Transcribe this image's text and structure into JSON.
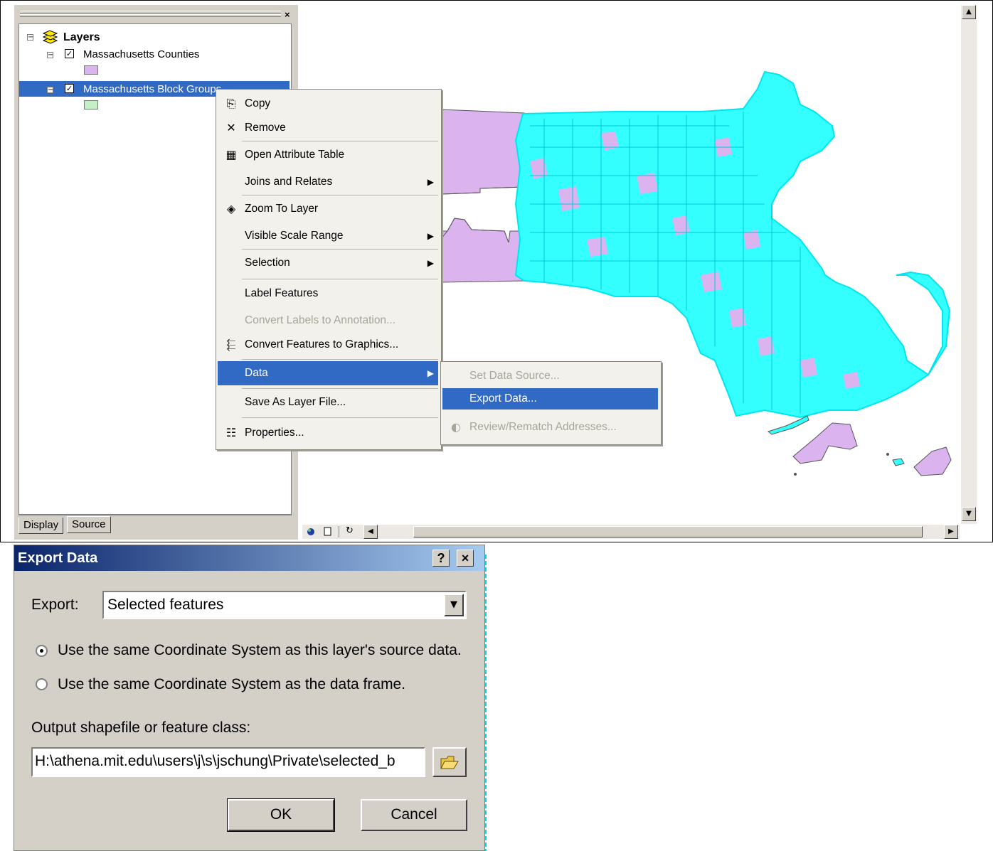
{
  "toc": {
    "close_glyph": "×",
    "root_label": "Layers",
    "layers": [
      {
        "name": "Massachusetts Counties",
        "checked": true,
        "swatch_color": "#dbb4ef"
      },
      {
        "name": "Massachusetts Block Groups",
        "checked": true,
        "swatch_color": "#c5f0c6",
        "selected": true
      }
    ],
    "tabs": {
      "display": "Display",
      "source": "Source"
    }
  },
  "map": {
    "county_fill": "#dbb4ef",
    "block_fill": "#33ffff",
    "toolbar_icons": [
      "globe-icon",
      "page-icon",
      "refresh-icon"
    ]
  },
  "context_menu": {
    "items": [
      {
        "label": "Copy",
        "icon": "copy-icon"
      },
      {
        "label": "Remove",
        "icon": "remove-icon"
      },
      {
        "label": "Open Attribute Table",
        "icon": "table-icon"
      },
      {
        "label": "Joins and Relates",
        "submenu": true
      },
      {
        "label": "Zoom To Layer",
        "icon": "zoom-to-layer-icon"
      },
      {
        "label": "Visible Scale Range",
        "submenu": true
      },
      {
        "label": "Selection",
        "submenu": true
      },
      {
        "label": "Label Features"
      },
      {
        "label": "Convert Labels to Annotation...",
        "disabled": true
      },
      {
        "label": "Convert Features to Graphics...",
        "icon": "convert-graphics-icon"
      },
      {
        "label": "Data",
        "submenu": true,
        "highlighted": true
      },
      {
        "label": "Save As Layer File..."
      },
      {
        "label": "Properties...",
        "icon": "properties-icon"
      }
    ]
  },
  "data_submenu": {
    "items": [
      {
        "label": "Set Data Source...",
        "disabled": true
      },
      {
        "label": "Export Data...",
        "highlighted": true
      },
      {
        "label": "Review/Rematch Addresses...",
        "disabled": true
      }
    ]
  },
  "dialog": {
    "title": "Export Data",
    "help_glyph": "?",
    "close_glyph": "×",
    "export_label": "Export:",
    "export_value": "Selected features",
    "radio_source_label": "Use the same Coordinate System as this layer's source data.",
    "radio_frame_label": "Use the same Coordinate System as the data frame.",
    "radio_selected": "source",
    "output_label": "Output shapefile or feature class:",
    "output_value": "H:\\athena.mit.edu\\users\\j\\s\\jschung\\Private\\selected_b",
    "ok_label": "OK",
    "cancel_label": "Cancel"
  }
}
